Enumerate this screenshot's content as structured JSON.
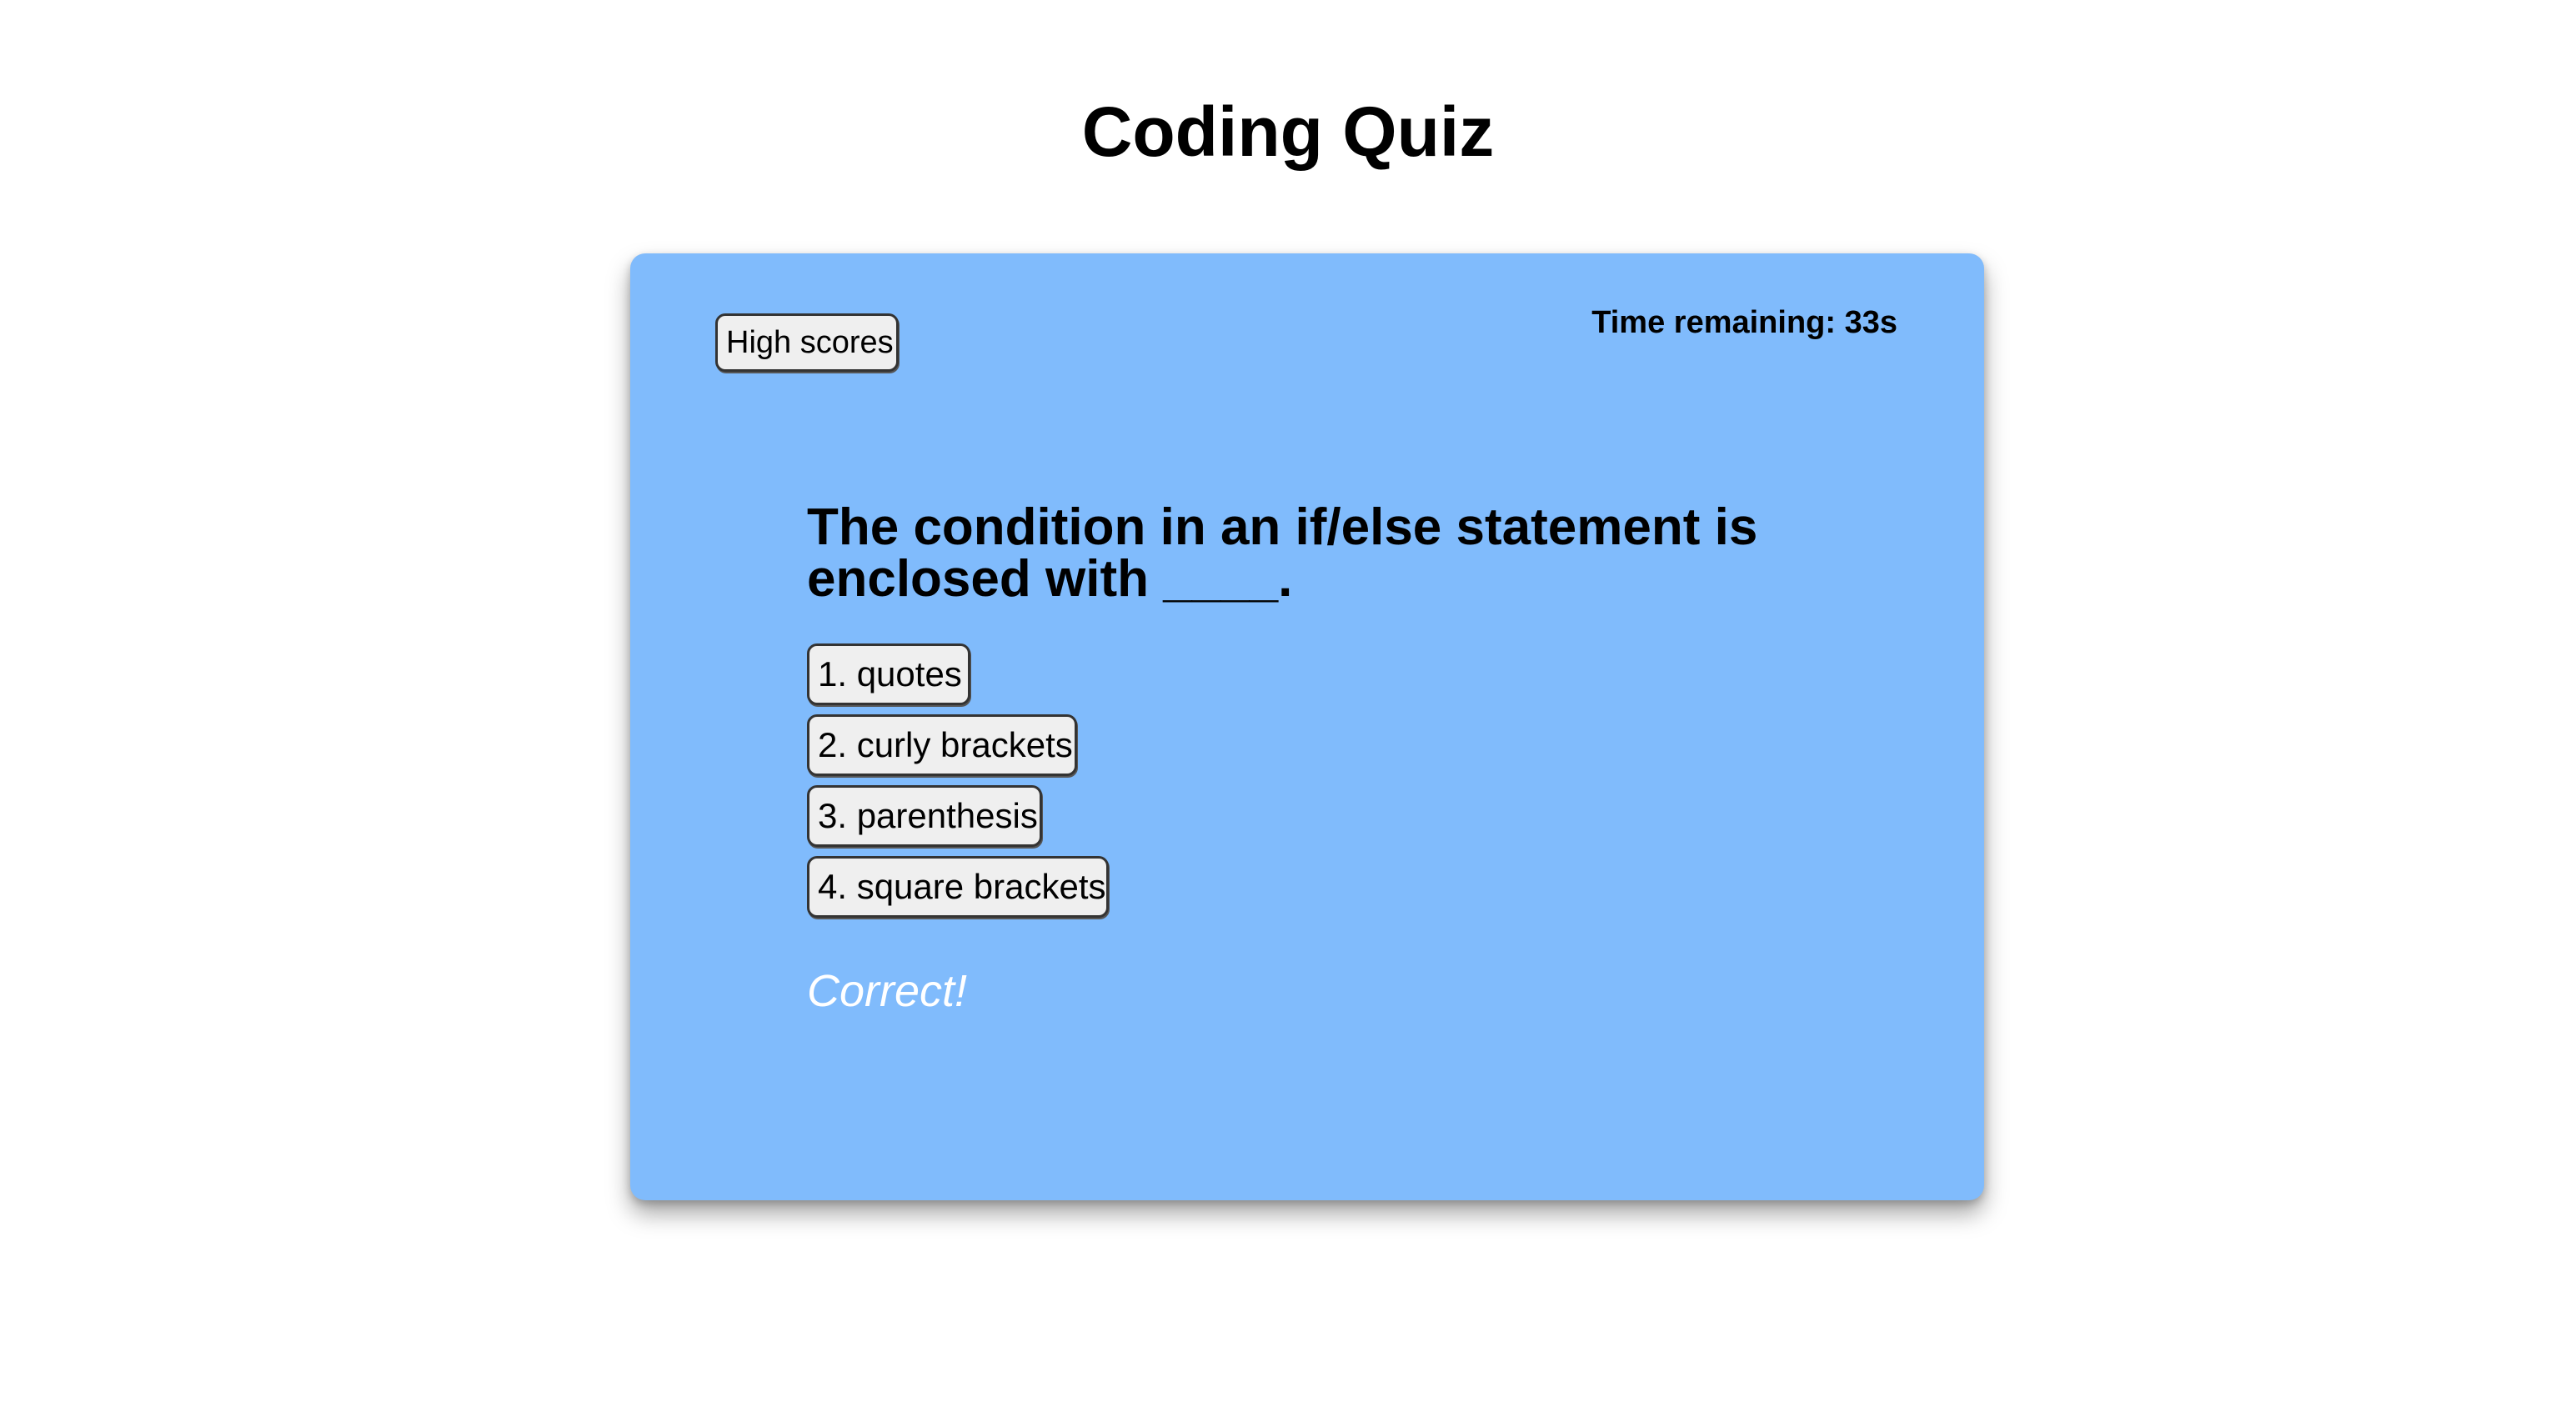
{
  "header": {
    "title": "Coding Quiz"
  },
  "quiz": {
    "high_scores_label": "High scores",
    "timer_text": "Time remaining: 33s",
    "question": "The condition in an if/else statement is enclosed with ____.",
    "answers": [
      {
        "label": "1. quotes"
      },
      {
        "label": "2. curly brackets"
      },
      {
        "label": "3. parenthesis"
      },
      {
        "label": "4. square brackets"
      }
    ],
    "feedback": "Correct!"
  },
  "colors": {
    "card_background": "#80bbfc",
    "feedback_text": "#ffffff",
    "button_background": "#efefef"
  }
}
